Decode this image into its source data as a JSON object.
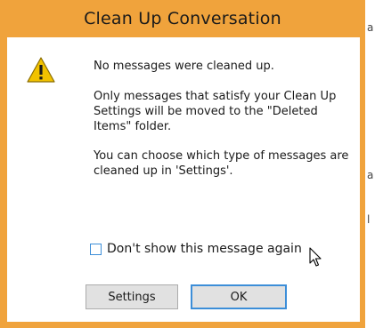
{
  "dialog": {
    "title": "Clean Up Conversation",
    "icon": "warning-icon",
    "accent_color": "#f0a33c",
    "message_headline": "No messages were cleaned up.",
    "message_detail_1": "Only messages that satisfy your Clean Up Settings will be moved to the \"Deleted Items\" folder.",
    "message_detail_2": "You can choose which type of messages are cleaned up in 'Settings'.",
    "checkbox": {
      "label": "Don't show this message again",
      "checked": false
    },
    "buttons": {
      "settings_label": "Settings",
      "ok_label": "OK"
    }
  },
  "background_fragments": [
    "a",
    "a",
    "l"
  ]
}
